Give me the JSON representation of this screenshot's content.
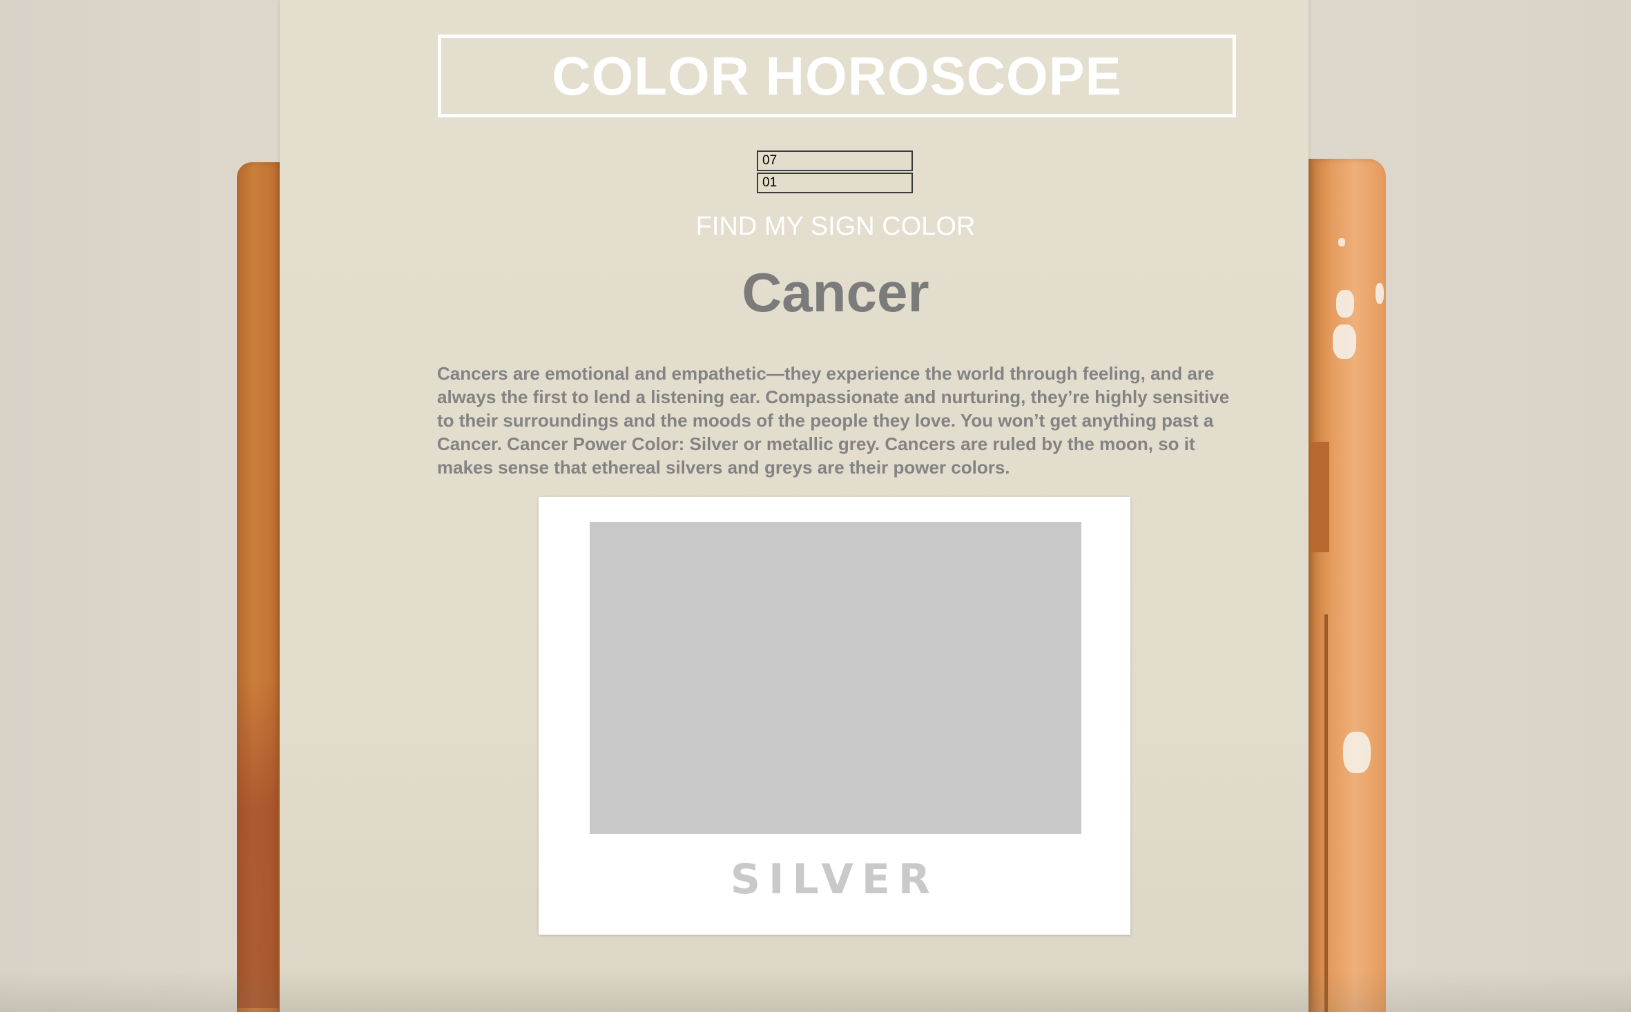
{
  "header": {
    "title": "COLOR HOROSCOPE"
  },
  "form": {
    "month_value": "07",
    "day_value": "01",
    "submit_label": "FIND MY SIGN COLOR"
  },
  "result": {
    "sign": "Cancer",
    "description": "Cancers are emotional and empathetic—they experience the world through feeling, and are always the first to lend a listening ear. Compassionate and nurturing, they’re highly sensitive to their surroundings and the moods of the people they love. You won’t get anything past a Cancer. Cancer Power Color: Silver or metallic grey. Cancers are ruled by the moon, so it makes sense that ethereal silvers and greys are their power colors.",
    "swatch": {
      "label": "SILVER",
      "color": "#c8c8c8"
    }
  },
  "colors": {
    "title_text": "#ffffff",
    "body_text": "#838383",
    "background": "#e2dccc",
    "easel_wood": "#cc7f3c"
  }
}
